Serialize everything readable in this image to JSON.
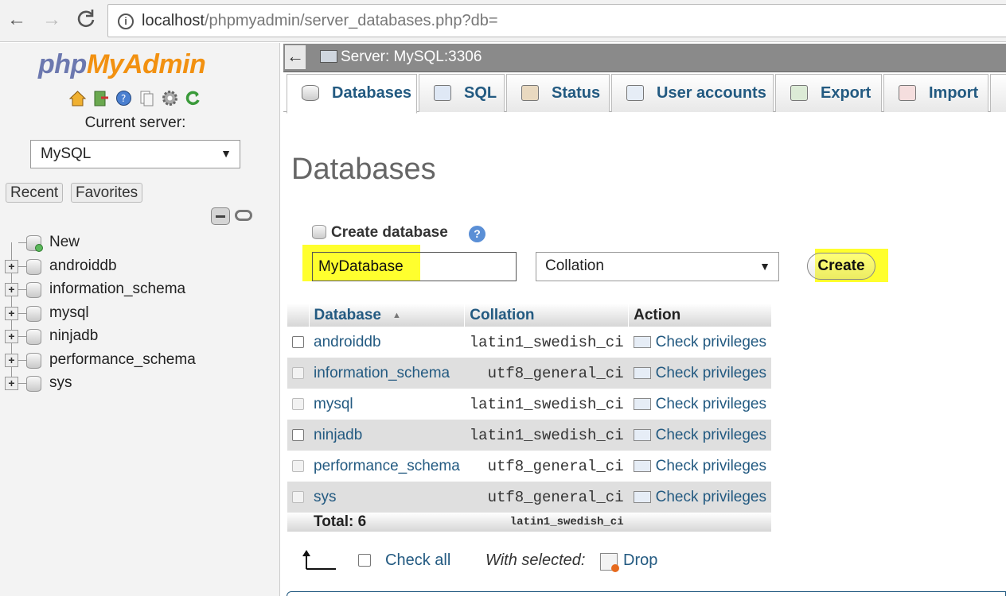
{
  "browser": {
    "url_host": "localhost",
    "url_path": "/phpmyadmin/server_databases.php?db=",
    "back_glyph": "←",
    "forward_glyph": "→",
    "reload_glyph": "C"
  },
  "sidebar": {
    "logo_php": "php",
    "logo_my": "My",
    "logo_admin": "Admin",
    "current_server_label": "Current server:",
    "server_value": "MySQL",
    "recent_label": "Recent",
    "favorites_label": "Favorites",
    "tree": [
      {
        "label": "New"
      },
      {
        "label": "androiddb"
      },
      {
        "label": "information_schema"
      },
      {
        "label": "mysql"
      },
      {
        "label": "ninjadb"
      },
      {
        "label": "performance_schema"
      },
      {
        "label": "sys"
      }
    ]
  },
  "header": {
    "back_glyph": "←",
    "server_title": "Server: MySQL:3306"
  },
  "tabs": [
    {
      "label": "Databases"
    },
    {
      "label": "SQL"
    },
    {
      "label": "Status"
    },
    {
      "label": "User accounts"
    },
    {
      "label": "Export"
    },
    {
      "label": "Import"
    }
  ],
  "main": {
    "title": "Databases",
    "create_label": "Create database",
    "help_glyph": "?",
    "dbname_value": "MyDatabase",
    "collation_value": "Collation",
    "create_button": "Create",
    "select_arrow_glyph": "↑",
    "check_all": "Check all",
    "with_selected": "With selected:",
    "drop_label": "Drop"
  },
  "table": {
    "headers": {
      "database": "Database",
      "collation": "Collation",
      "action": "Action",
      "sort_glyph": "▲"
    },
    "rows": [
      {
        "name": "androiddb",
        "collation": "latin1_swedish_ci",
        "action": "Check privileges"
      },
      {
        "name": "information_schema",
        "collation": "utf8_general_ci",
        "action": "Check privileges"
      },
      {
        "name": "mysql",
        "collation": "latin1_swedish_ci",
        "action": "Check privileges"
      },
      {
        "name": "ninjadb",
        "collation": "latin1_swedish_ci",
        "action": "Check privileges"
      },
      {
        "name": "performance_schema",
        "collation": "utf8_general_ci",
        "action": "Check privileges"
      },
      {
        "name": "sys",
        "collation": "utf8_general_ci",
        "action": "Check privileges"
      }
    ],
    "total_label": "Total: 6",
    "total_collation": "latin1_swedish_ci"
  },
  "colors": {
    "highlight": "#ffff2e",
    "link": "#235a81",
    "header_bar": "#8a8a8a"
  }
}
